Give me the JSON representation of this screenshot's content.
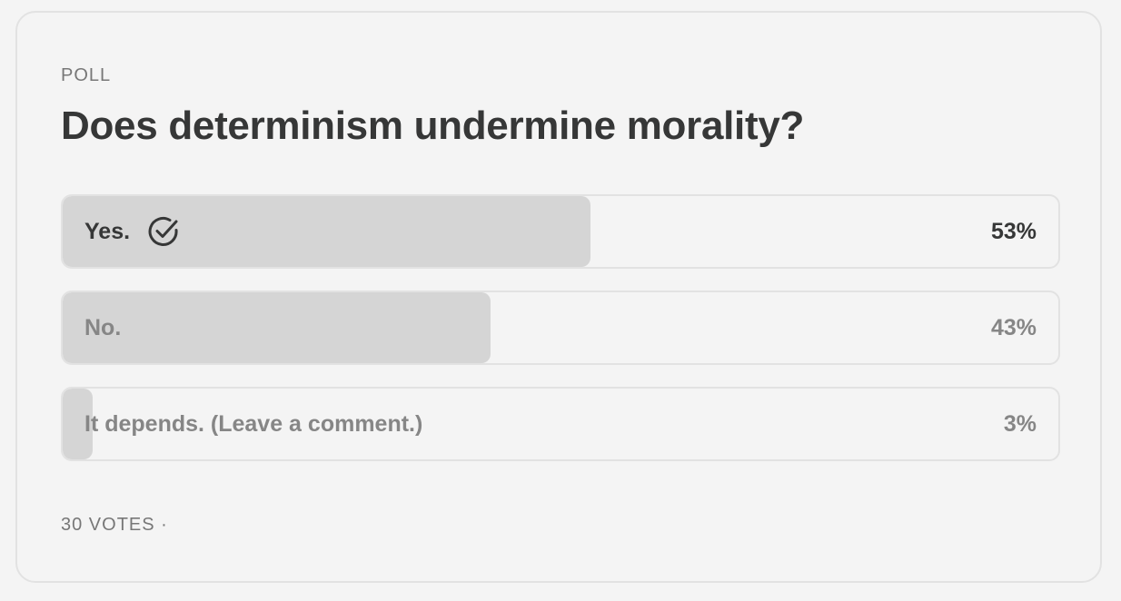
{
  "poll": {
    "label": "POLL",
    "question": "Does determinism undermine morality?",
    "options": [
      {
        "label": "Yes.",
        "percent_text": "53%",
        "percent": 53,
        "selected": true
      },
      {
        "label": "No.",
        "percent_text": "43%",
        "percent": 43,
        "selected": false
      },
      {
        "label": "It depends. (Leave a comment.)",
        "percent_text": "3%",
        "percent": 3,
        "selected": false
      }
    ],
    "footer": "30 VOTES ·",
    "selected_icon": "check-circle-icon"
  },
  "colors": {
    "background": "#f4f4f4",
    "border": "#e2e2e2",
    "fill": "#d5d5d5",
    "text_primary": "#363737",
    "text_muted": "#868686"
  }
}
